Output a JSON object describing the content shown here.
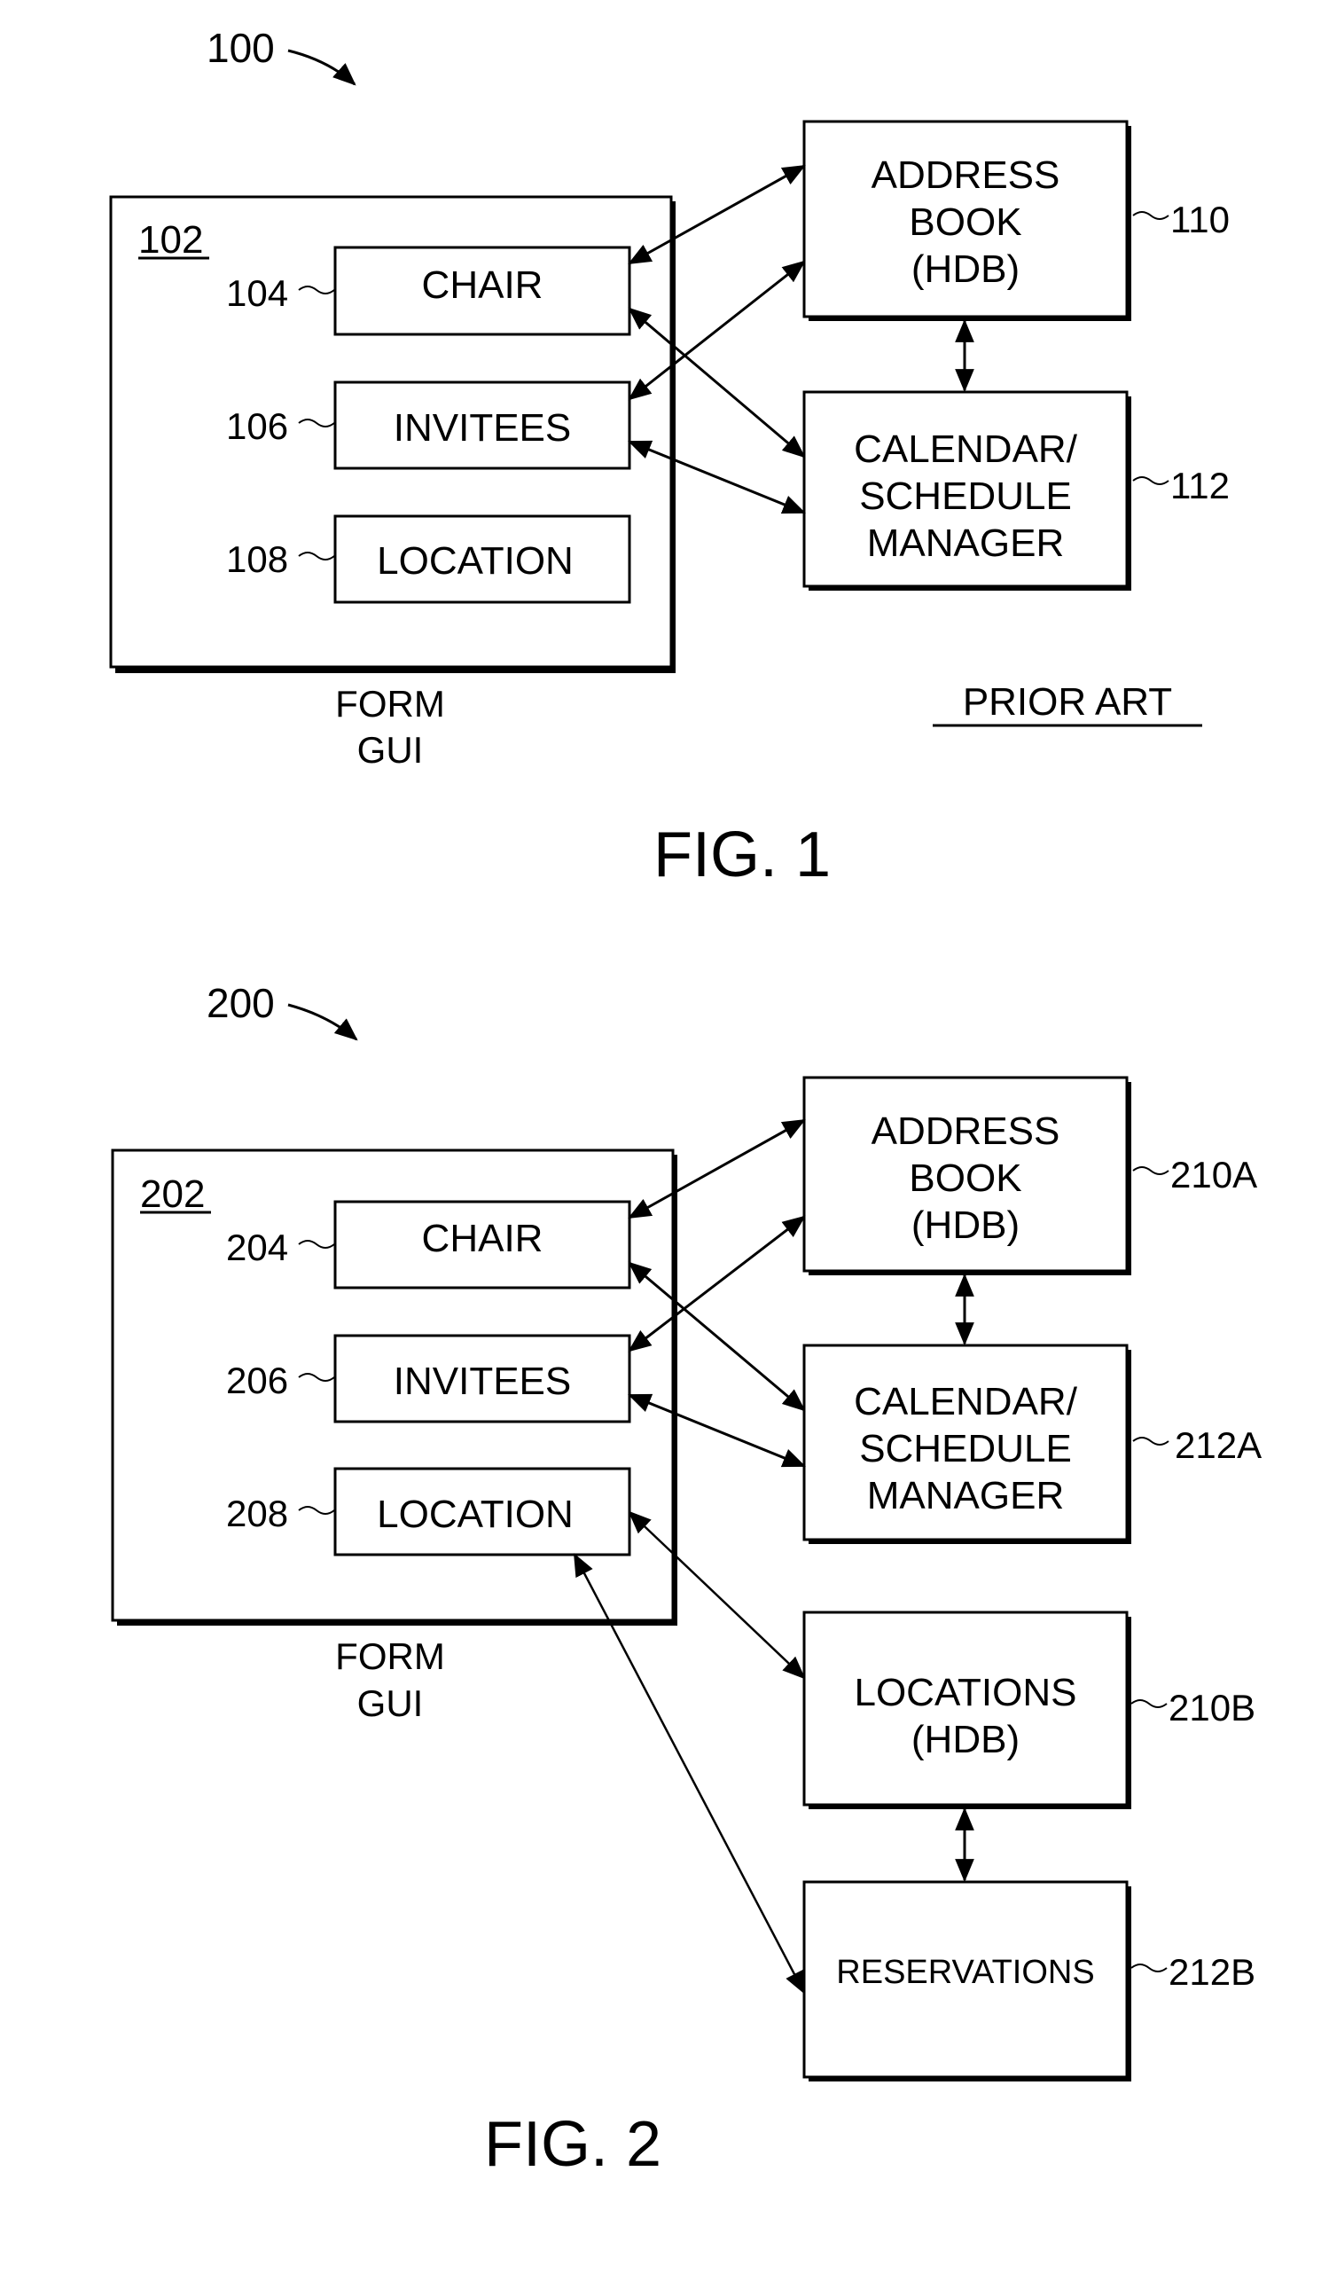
{
  "figures": [
    {
      "id": "fig1",
      "ref": "100",
      "caption": "FIG. 1",
      "note": "PRIOR ART",
      "form": {
        "ref": "102",
        "label_line1": "FORM",
        "label_line2": "GUI",
        "fields": [
          {
            "ref": "104",
            "label": "CHAIR"
          },
          {
            "ref": "106",
            "label": "INVITEES"
          },
          {
            "ref": "108",
            "label": "LOCATION"
          }
        ]
      },
      "modules": [
        {
          "ref": "110",
          "lines": [
            "ADDRESS",
            "BOOK",
            "(HDB)"
          ]
        },
        {
          "ref": "112",
          "lines": [
            "CALENDAR/",
            "SCHEDULE",
            "MANAGER"
          ]
        }
      ],
      "connections": [
        {
          "from": "CHAIR",
          "to": "ADDRESS BOOK (HDB)",
          "bidirectional": true
        },
        {
          "from": "CHAIR",
          "to": "CALENDAR/SCHEDULE MANAGER",
          "bidirectional": true
        },
        {
          "from": "INVITEES",
          "to": "ADDRESS BOOK (HDB)",
          "bidirectional": true
        },
        {
          "from": "INVITEES",
          "to": "CALENDAR/SCHEDULE MANAGER",
          "bidirectional": true
        },
        {
          "from": "ADDRESS BOOK (HDB)",
          "to": "CALENDAR/SCHEDULE MANAGER",
          "bidirectional": true
        }
      ]
    },
    {
      "id": "fig2",
      "ref": "200",
      "caption": "FIG. 2",
      "form": {
        "ref": "202",
        "label_line1": "FORM",
        "label_line2": "GUI",
        "fields": [
          {
            "ref": "204",
            "label": "CHAIR"
          },
          {
            "ref": "206",
            "label": "INVITEES"
          },
          {
            "ref": "208",
            "label": "LOCATION"
          }
        ]
      },
      "modules": [
        {
          "ref": "210A",
          "lines": [
            "ADDRESS",
            "BOOK",
            "(HDB)"
          ]
        },
        {
          "ref": "212A",
          "lines": [
            "CALENDAR/",
            "SCHEDULE",
            "MANAGER"
          ]
        },
        {
          "ref": "210B",
          "lines": [
            "LOCATIONS",
            "(HDB)"
          ]
        },
        {
          "ref": "212B",
          "lines": [
            "RESERVATIONS"
          ]
        }
      ],
      "connections": [
        {
          "from": "CHAIR",
          "to": "ADDRESS BOOK (HDB)",
          "bidirectional": true
        },
        {
          "from": "CHAIR",
          "to": "CALENDAR/SCHEDULE MANAGER",
          "bidirectional": true
        },
        {
          "from": "INVITEES",
          "to": "ADDRESS BOOK (HDB)",
          "bidirectional": true
        },
        {
          "from": "INVITEES",
          "to": "CALENDAR/SCHEDULE MANAGER",
          "bidirectional": true
        },
        {
          "from": "ADDRESS BOOK (HDB)",
          "to": "CALENDAR/SCHEDULE MANAGER",
          "bidirectional": true
        },
        {
          "from": "LOCATION",
          "to": "LOCATIONS (HDB)",
          "bidirectional": true
        },
        {
          "from": "LOCATION",
          "to": "RESERVATIONS",
          "bidirectional": true
        },
        {
          "from": "LOCATIONS (HDB)",
          "to": "RESERVATIONS",
          "bidirectional": true
        }
      ]
    }
  ]
}
